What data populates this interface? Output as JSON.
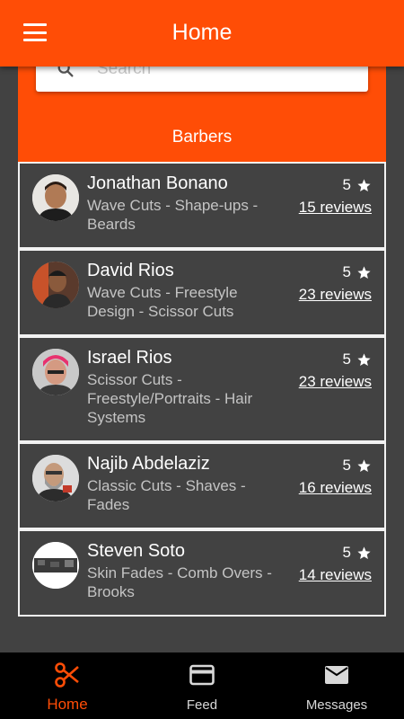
{
  "app_bar": {
    "title": "Home",
    "menu_icon": "hamburger-menu-icon"
  },
  "search": {
    "placeholder": "Search",
    "icon": "search-icon"
  },
  "section_title": "Barbers",
  "barbers": [
    {
      "name": "Jonathan Bonano",
      "specialties": "Wave Cuts - Shape-ups - Beards",
      "rating": "5",
      "reviews": "15 reviews"
    },
    {
      "name": "David Rios",
      "specialties": "Wave Cuts - Freestyle Design - Scissor Cuts",
      "rating": "5",
      "reviews": "23 reviews"
    },
    {
      "name": "Israel Rios",
      "specialties": "Scissor Cuts - Freestyle/Portraits - Hair Systems",
      "rating": "5",
      "reviews": "23 reviews"
    },
    {
      "name": "Najib Abdelaziz",
      "specialties": "Classic Cuts - Shaves - Fades",
      "rating": "5",
      "reviews": "16 reviews"
    },
    {
      "name": "Steven Soto",
      "specialties": "Skin Fades - Comb Overs - Brooks",
      "rating": "5",
      "reviews": "14 reviews"
    }
  ],
  "bottom_nav": [
    {
      "label": "Home",
      "icon": "scissors-icon",
      "active": true
    },
    {
      "label": "Feed",
      "icon": "card-icon",
      "active": false
    },
    {
      "label": "Messages",
      "icon": "mail-icon",
      "active": false
    }
  ],
  "colors": {
    "accent": "#ff4d06",
    "background": "#424242",
    "nav_background": "#000000"
  }
}
